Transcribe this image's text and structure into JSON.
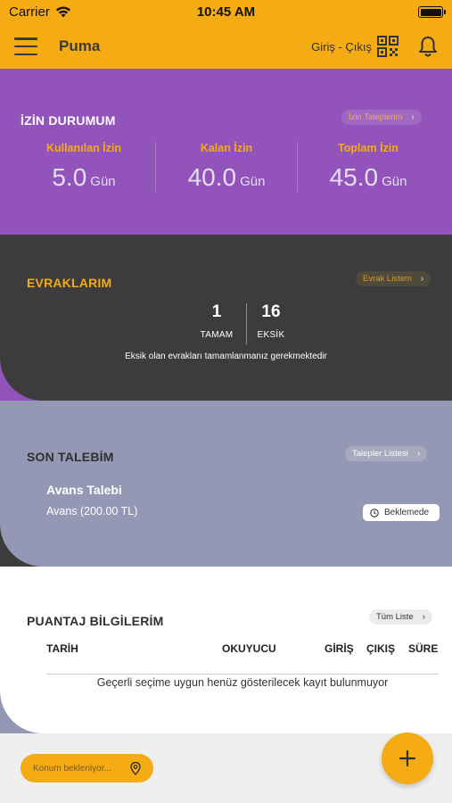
{
  "status_bar": {
    "carrier": "Carrier",
    "time": "10:45 AM"
  },
  "nav": {
    "title": "Puma",
    "checkin_label": "Giriş - Çıkış"
  },
  "leave": {
    "title": "İZİN DURUMUM",
    "link_label": "İzin Taleplerim",
    "stats": [
      {
        "label": "Kullanılan İzin",
        "value": "5.0",
        "unit": "Gün"
      },
      {
        "label": "Kalan İzin",
        "value": "40.0",
        "unit": "Gün"
      },
      {
        "label": "Toplam İzin",
        "value": "45.0",
        "unit": "Gün"
      }
    ]
  },
  "documents": {
    "title": "EVRAKLARIM",
    "link_label": "Evrak Listem",
    "complete_count": "1",
    "complete_label": "TAMAM",
    "missing_count": "16",
    "missing_label": "EKSİK",
    "message": "Eksik olan evrakları tamamlanmanız gerekmektedir"
  },
  "last_request": {
    "title": "SON TALEBİM",
    "link_label": "Talepler Listesi",
    "request_title": "Avans Talebi",
    "request_detail": "Avans (200.00 TL)",
    "status": "Beklemede"
  },
  "timesheet": {
    "title": "PUANTAJ BİLGİLERİM",
    "link_label": "Tüm Liste",
    "columns": [
      "TARİH",
      "OKUYUCU",
      "GİRİŞ",
      "ÇIKIŞ",
      "SÜRE"
    ],
    "empty_message": "Geçerli seçime uygun henüz gösterilecek kayıt bulunmuyor"
  },
  "location": {
    "label": "Konum bekleniyor..."
  },
  "colors": {
    "accent": "#f5ab14",
    "leave_bg": "#9254bb",
    "docs_bg": "#3c3c3c",
    "request_bg": "#9598b4"
  }
}
